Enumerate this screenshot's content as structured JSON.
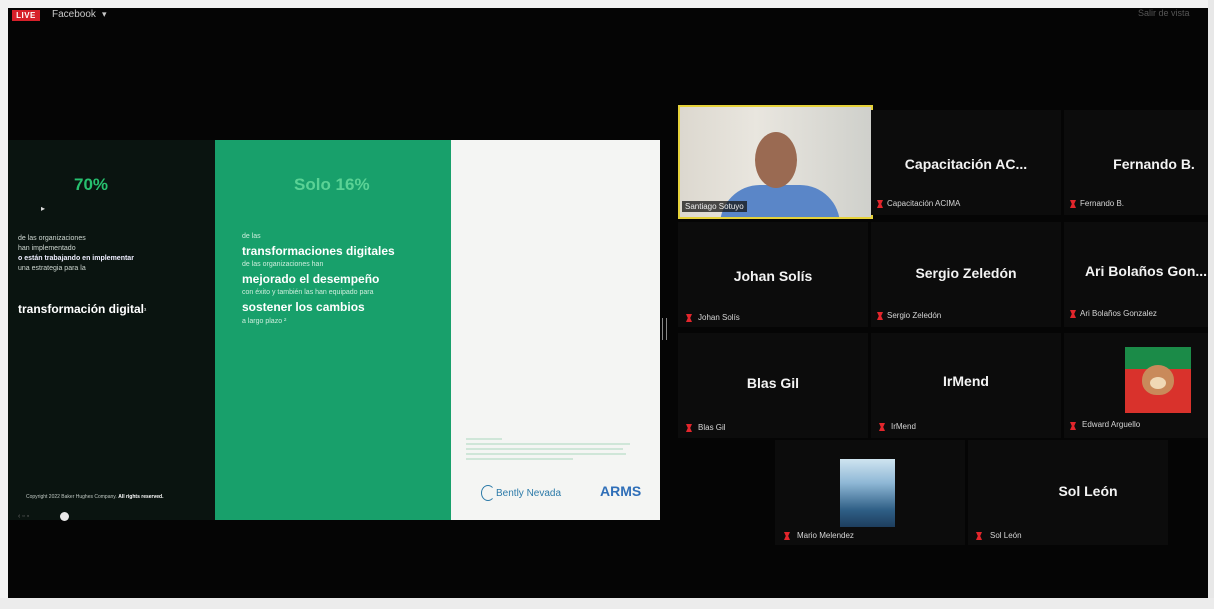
{
  "topbar": {
    "live_label": "LIVE",
    "platform_label": "Facebook",
    "caret": "▾",
    "exit_label": "Salir de vista"
  },
  "slide": {
    "dark": {
      "stat": "70%",
      "lines": [
        "de las organizaciones",
        "han implementado",
        "o están trabajando en implementar",
        "una estrategia para la"
      ],
      "headline": "transformación digital",
      "headline_suffix": "¹",
      "copyright_prefix": "Copyright 2022 Baker Hughes Company.",
      "copyright_bold": "All rights reserved."
    },
    "green": {
      "stat": "Solo 16%",
      "line_1": "de las",
      "big_1": "transformaciones digitales",
      "line_2": "de las organizaciones han",
      "big_2": "mejorado el desempeño",
      "line_3": "con éxito y también las han equipado para",
      "big_3": "sostener los cambios",
      "line_4": "a largo plazo ²"
    },
    "white": {
      "brand_1": "Bently Nevada",
      "brand_2": "ARMS"
    }
  },
  "participants": [
    {
      "label": "Santiago Sotuyo",
      "display": "",
      "type": "video"
    },
    {
      "label": "Capacitación ACIMA",
      "display": "Capacitación AC...",
      "type": "name"
    },
    {
      "label": "Fernando B.",
      "display": "Fernando B.",
      "type": "name"
    },
    {
      "label": "Johan Solís",
      "display": "Johan Solís",
      "type": "name"
    },
    {
      "label": "Sergio Zeledón",
      "display": "Sergio Zeledón",
      "type": "name"
    },
    {
      "label": "Ari Bolaños Gonzalez",
      "display": "Ari Bolaños Gon...",
      "type": "name"
    },
    {
      "label": "Blas Gil",
      "display": "Blas Gil",
      "type": "name"
    },
    {
      "label": "IrMend",
      "display": "IrMend",
      "type": "name"
    },
    {
      "label": "Edward Arguello",
      "display": "",
      "type": "image"
    },
    {
      "label": "Mario Melendez",
      "display": "",
      "type": "image"
    },
    {
      "label": "Sol León",
      "display": "Sol León",
      "type": "name"
    }
  ],
  "colors": {
    "mic_muted": "#e3262c",
    "active_speaker_border": "#e6d23a",
    "slide_green": "#18a06b",
    "stat_green": "#27c06f"
  },
  "icons": {
    "mic": "microphone-muted-icon",
    "cursor": "mouse-pointer-icon"
  }
}
